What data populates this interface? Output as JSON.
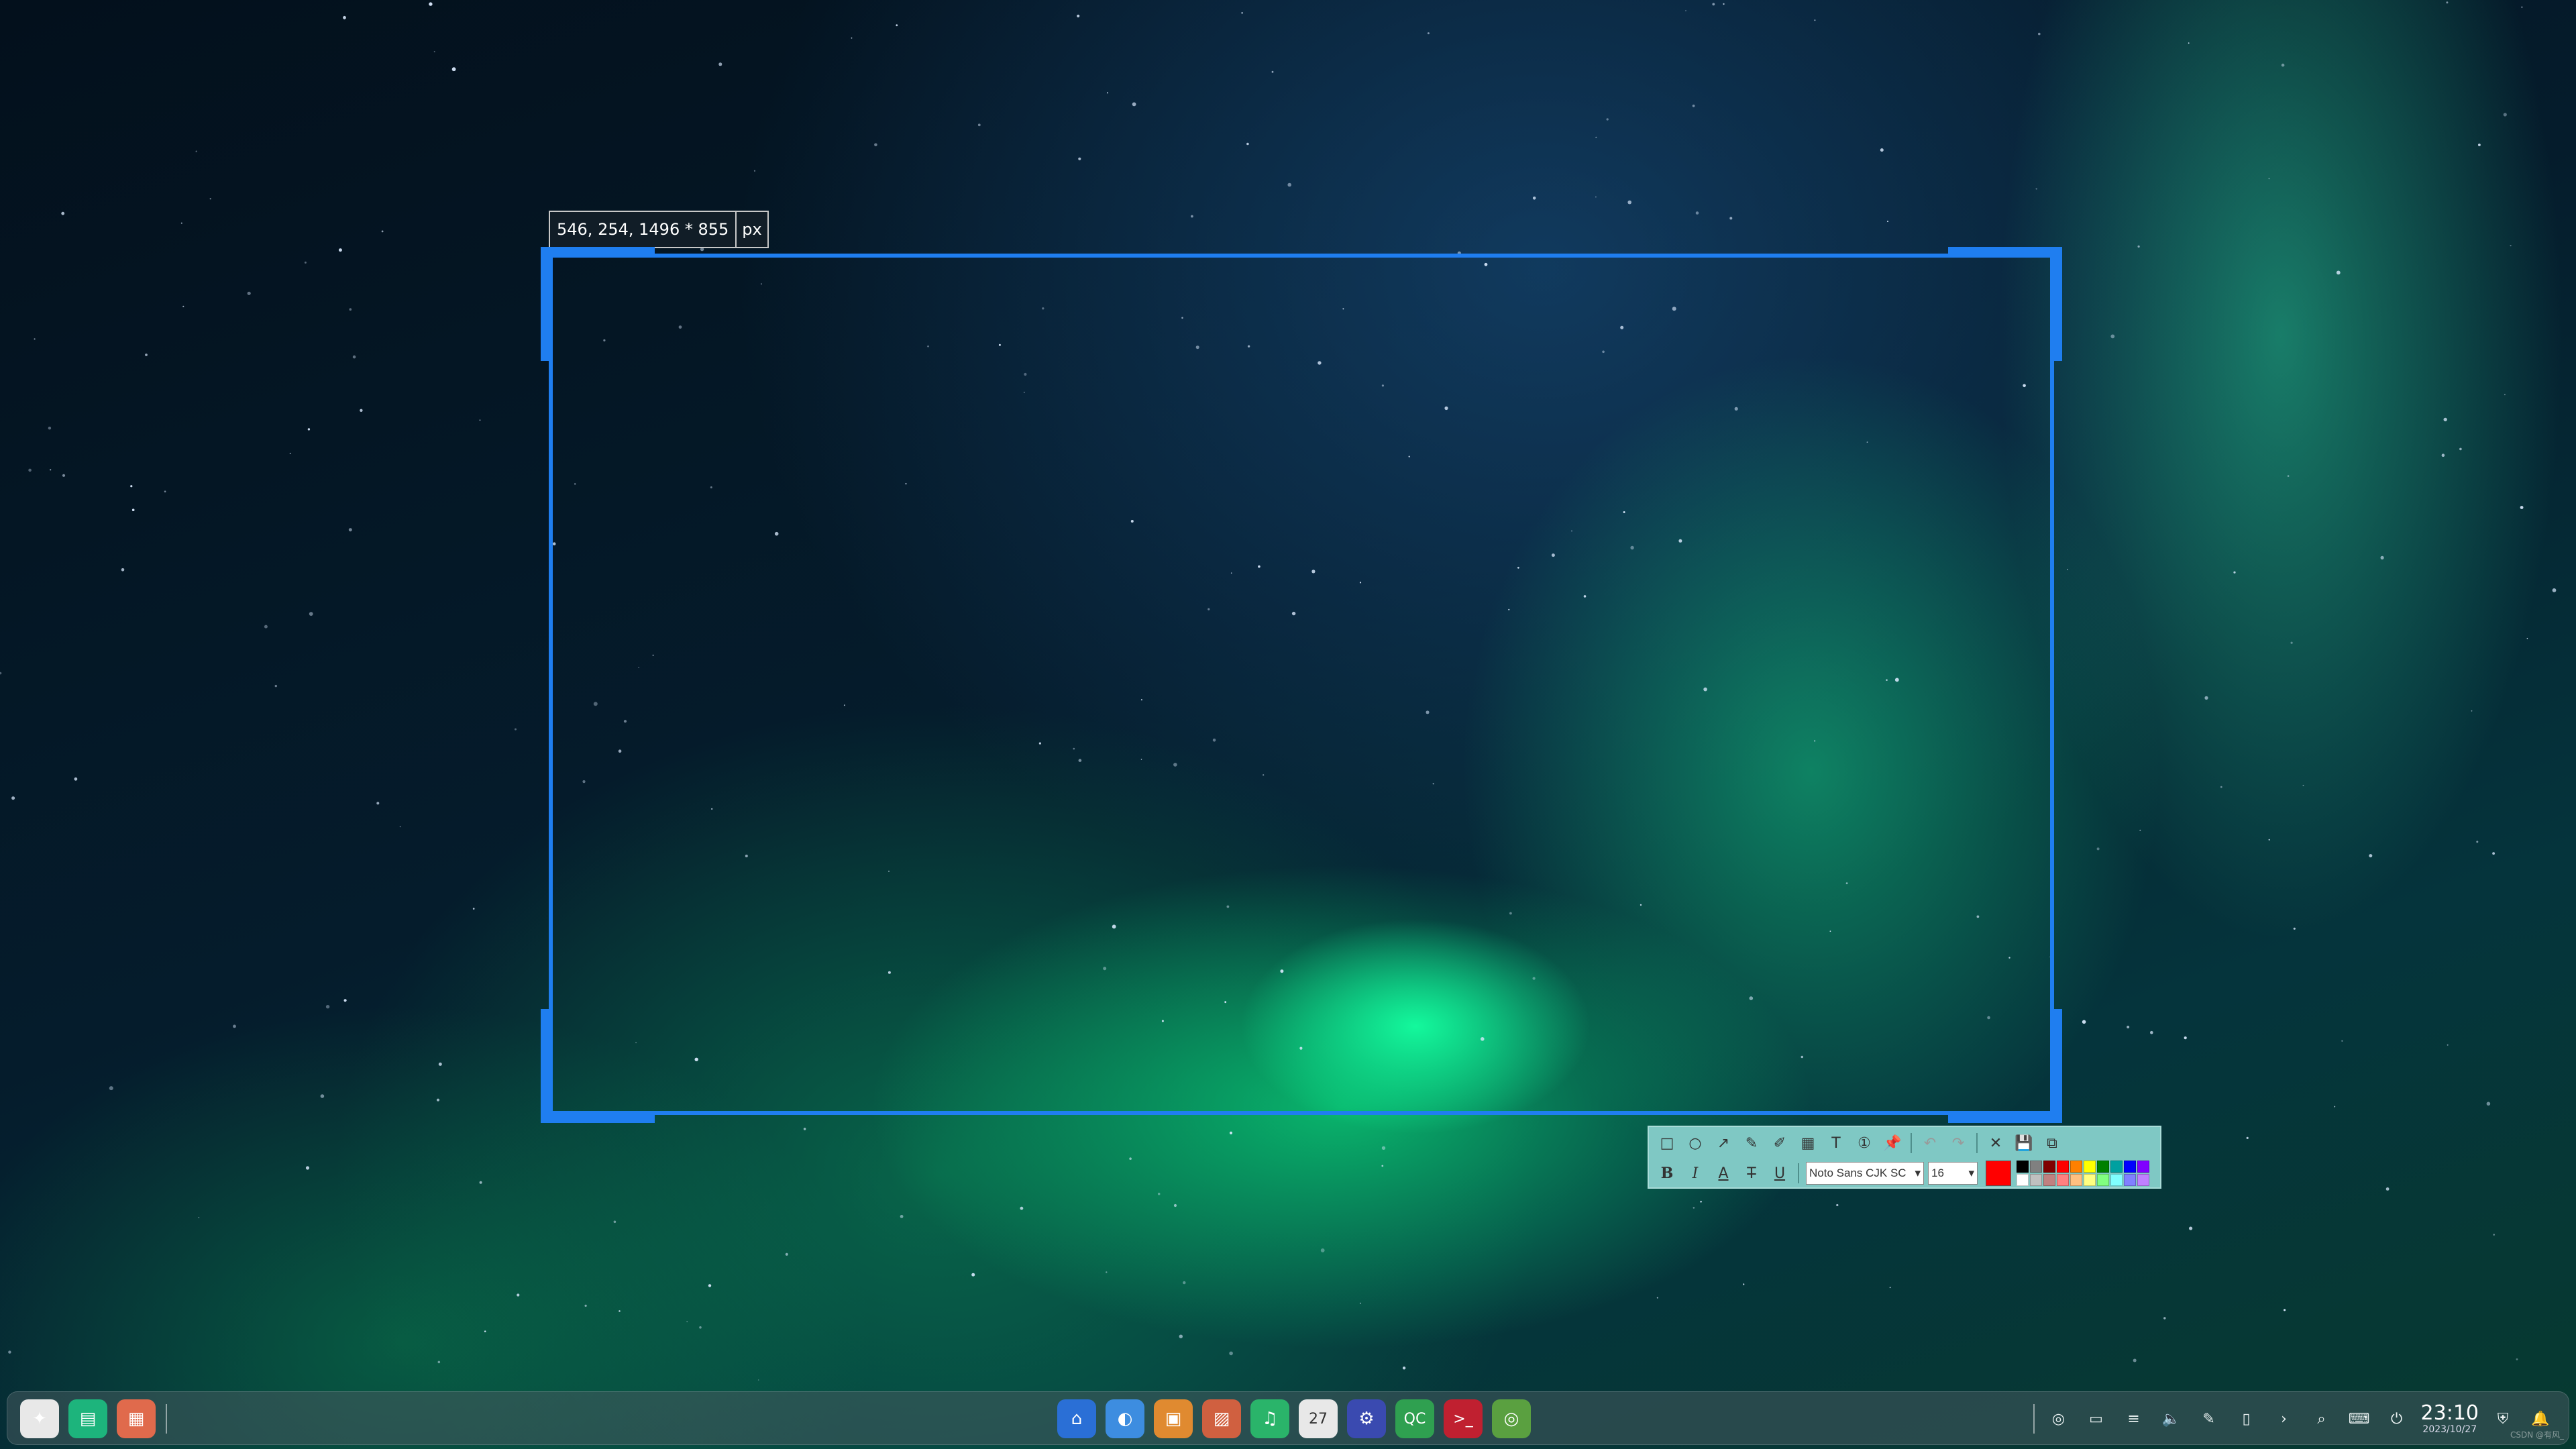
{
  "screenshot_tool": {
    "size_label": {
      "dimensions": "546, 254, 1496 * 855",
      "unit": "px"
    },
    "toolbar": {
      "row1": [
        {
          "name": "rectangle-tool",
          "icon": "rectangle-icon",
          "glyph": "□"
        },
        {
          "name": "ellipse-tool",
          "icon": "ellipse-icon",
          "glyph": "○"
        },
        {
          "name": "arrow-tool",
          "icon": "arrow-icon",
          "glyph": "↗"
        },
        {
          "name": "pen-tool",
          "icon": "pen-icon",
          "glyph": "✎"
        },
        {
          "name": "marker-tool",
          "icon": "marker-icon",
          "glyph": "✐"
        },
        {
          "name": "mosaic-tool",
          "icon": "mosaic-icon",
          "glyph": "▦"
        },
        {
          "name": "text-tool",
          "icon": "text-icon",
          "glyph": "T"
        },
        {
          "name": "number-tool",
          "icon": "serial-number-icon",
          "glyph": "①"
        },
        {
          "name": "pin-tool",
          "icon": "pin-icon",
          "glyph": "📌"
        },
        {
          "name": "undo-button",
          "icon": "undo-icon",
          "glyph": "↶",
          "disabled": true
        },
        {
          "name": "redo-button",
          "icon": "redo-icon",
          "glyph": "↷",
          "disabled": true
        },
        {
          "name": "close-button",
          "icon": "close-icon",
          "glyph": "✕"
        },
        {
          "name": "save-button",
          "icon": "save-icon",
          "glyph": "💾"
        },
        {
          "name": "copy-button",
          "icon": "copy-icon",
          "glyph": "⧉"
        }
      ],
      "row2": {
        "bold": "B",
        "italic": "I",
        "font_color": "A",
        "strikethrough": "T",
        "underline": "U",
        "font_family": "Noto Sans CJK SC",
        "font_size": "16",
        "current_color": "#ff0000",
        "palette": [
          "#000000",
          "#808080",
          "#800000",
          "#ff0000",
          "#ff8000",
          "#ffff00",
          "#008000",
          "#00a0a0",
          "#0000ff",
          "#8000ff",
          "#ffffff",
          "#c0c0c0",
          "#c08080",
          "#ff8080",
          "#ffc080",
          "#ffff80",
          "#80ff80",
          "#80ffff",
          "#8080ff",
          "#c080ff"
        ]
      }
    }
  },
  "taskbar": {
    "left_apps": [
      {
        "name": "launcher",
        "icon": "launcher-icon",
        "glyph": "✦",
        "color": "#e8e8e8"
      },
      {
        "name": "multitasking-view",
        "icon": "multitask-icon",
        "glyph": "▤",
        "color": "#1db47c"
      },
      {
        "name": "show-desktop",
        "icon": "workspace-icon",
        "glyph": "▦",
        "color": "#e06a4c"
      }
    ],
    "center_apps": [
      {
        "name": "app-store",
        "icon": "app-store-icon",
        "glyph": "⌂",
        "color": "#2a6fd6"
      },
      {
        "name": "browser",
        "icon": "browser-icon",
        "glyph": "◐",
        "color": "#3d8de0"
      },
      {
        "name": "archive-manager",
        "icon": "archive-icon",
        "glyph": "▣",
        "color": "#e08a30"
      },
      {
        "name": "image-viewer",
        "icon": "image-viewer-icon",
        "glyph": "▨",
        "color": "#d06040"
      },
      {
        "name": "music",
        "icon": "music-icon",
        "glyph": "♫",
        "color": "#2ab46a"
      },
      {
        "name": "calendar",
        "icon": "calendar-icon",
        "glyph": "27",
        "color": "#e8e8e8"
      },
      {
        "name": "system-settings",
        "icon": "settings-icon",
        "glyph": "⚙",
        "color": "#3a4ab0"
      },
      {
        "name": "qt-creator",
        "icon": "qt-creator-icon",
        "glyph": "QC",
        "color": "#2fa050"
      },
      {
        "name": "terminal",
        "icon": "terminal-icon",
        "glyph": ">_",
        "color": "#c02030"
      },
      {
        "name": "screenshot-app",
        "icon": "screenshot-icon",
        "glyph": "◎",
        "color": "#5aa040"
      }
    ],
    "tray": [
      {
        "name": "tray-screenshot",
        "icon": "screenshot-icon",
        "glyph": "◎"
      },
      {
        "name": "tray-display",
        "icon": "display-icon",
        "glyph": "▭"
      },
      {
        "name": "tray-menu",
        "icon": "menu-icon",
        "glyph": "≡"
      },
      {
        "name": "tray-volume",
        "icon": "volume-icon",
        "glyph": "🔈"
      },
      {
        "name": "tray-pen",
        "icon": "pen-icon",
        "glyph": "✎"
      },
      {
        "name": "tray-mouse",
        "icon": "mouse-icon",
        "glyph": "▯"
      },
      {
        "name": "tray-expand",
        "icon": "chevron-right-icon",
        "glyph": "›"
      },
      {
        "name": "tray-search",
        "icon": "search-icon",
        "glyph": "⌕"
      },
      {
        "name": "tray-keyboard",
        "icon": "keyboard-icon",
        "glyph": "⌨"
      },
      {
        "name": "tray-power",
        "icon": "power-icon",
        "glyph": "⏻"
      }
    ],
    "clock": {
      "time": "23:10",
      "date": "2023/10/27"
    },
    "after_clock": [
      {
        "name": "tray-security",
        "icon": "security-shield-icon",
        "glyph": "⛨"
      },
      {
        "name": "tray-notifications",
        "icon": "bell-icon",
        "glyph": "🔔"
      }
    ]
  },
  "watermark": "CSDN @有风_"
}
